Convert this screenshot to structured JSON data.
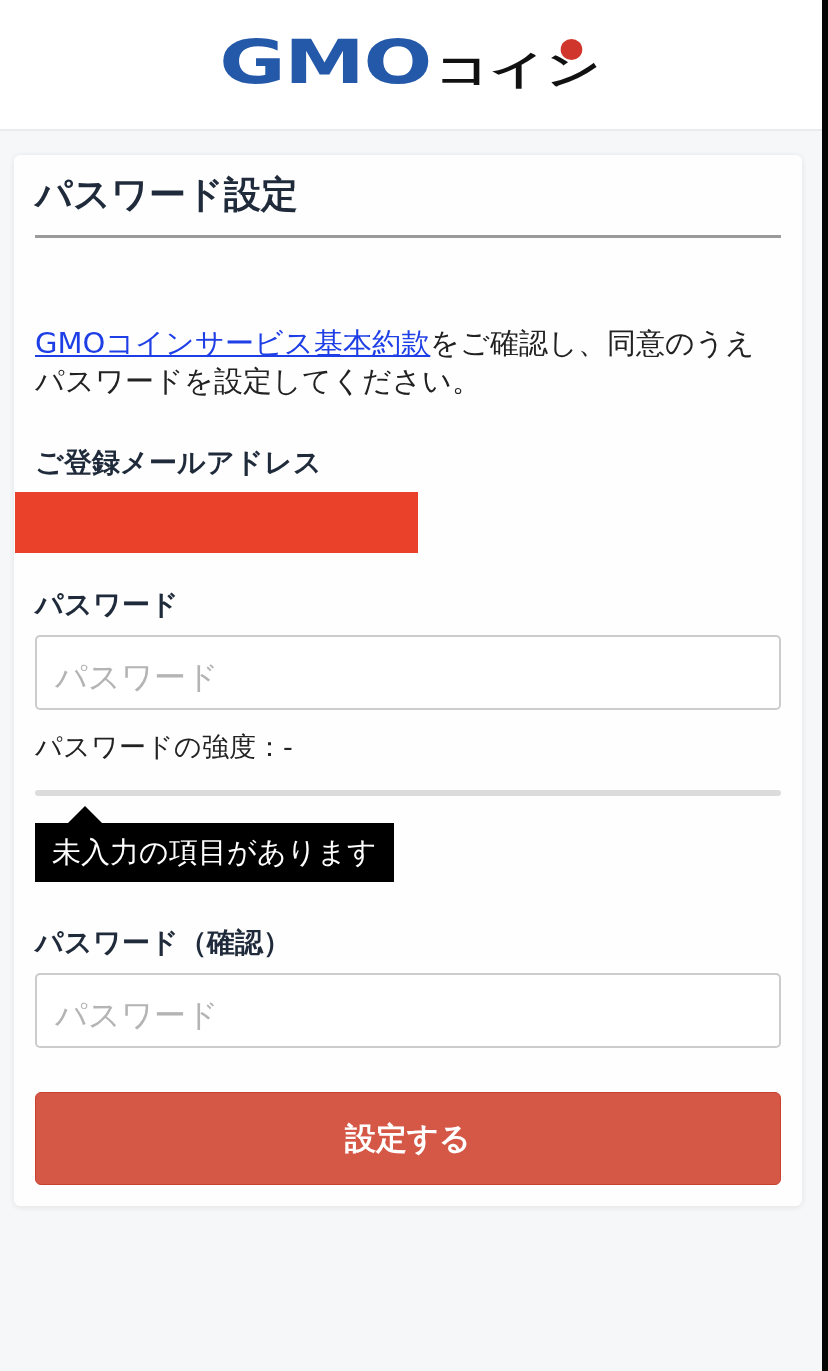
{
  "header": {
    "logo": {
      "latin": "GMO",
      "kana": "コイン"
    }
  },
  "card": {
    "title": "パスワード設定",
    "intro": {
      "link": "GMOコインサービス基本約款",
      "text": "をご確認し、同意のうえパスワードを設定してください。"
    },
    "email": {
      "label": "ご登録メールアドレス",
      "redacted": true
    },
    "password": {
      "label": "パスワード",
      "placeholder": "パスワード",
      "strength_label": "パスワードの強度：-",
      "strength": {
        "level": 0
      },
      "tooltip": "未入力の項目があります"
    },
    "password_confirm": {
      "label": "パスワード（確認）",
      "placeholder": "パスワード"
    },
    "submit_button": "設定する"
  }
}
